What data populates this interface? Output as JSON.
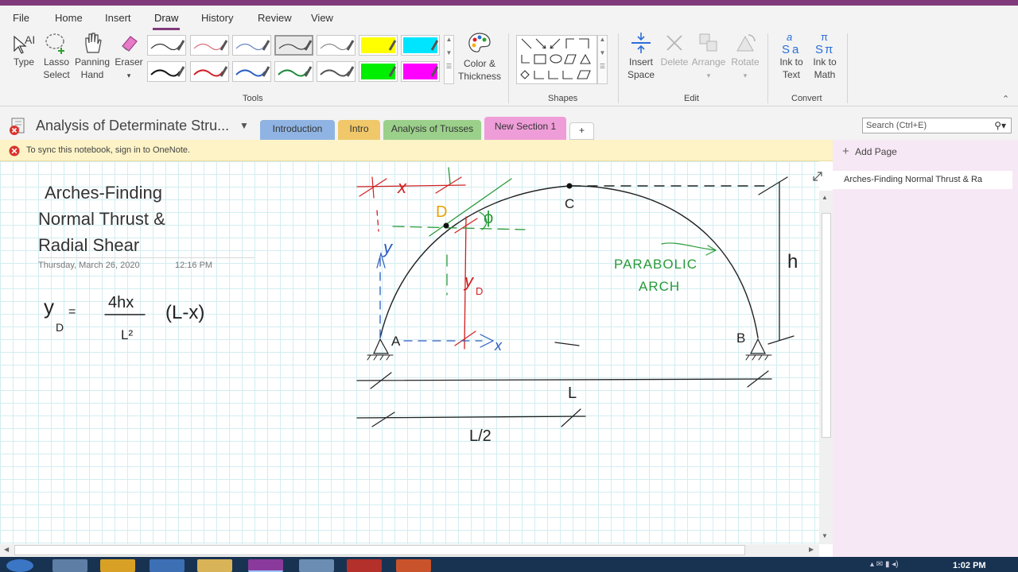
{
  "menu": {
    "items": [
      "File",
      "Home",
      "Insert",
      "Draw",
      "History",
      "Review",
      "View"
    ],
    "active": "Draw"
  },
  "ribbon": {
    "tools": {
      "type": "Type",
      "lasso": [
        "Lasso",
        "Select"
      ],
      "panning": [
        "Panning",
        "Hand"
      ],
      "eraser": "Eraser",
      "color_thickness": [
        "Color &",
        "Thickness"
      ],
      "insert_space": [
        "Insert",
        "Space"
      ],
      "delete": "Delete",
      "arrange": "Arrange",
      "rotate": "Rotate",
      "ink_to_text": [
        "Ink to",
        "Text"
      ],
      "ink_to_math": [
        "Ink to",
        "Math"
      ]
    },
    "groups": {
      "tools": "Tools",
      "shapes": "Shapes",
      "edit": "Edit",
      "convert": "Convert"
    },
    "pen_colors": [
      "#333333",
      "#d9707a",
      "#6b85c4",
      "#3c3c3c",
      "#8c8c8c",
      "#ffff00",
      "#00e5ff",
      "#111111",
      "#d0202a",
      "#2c5fc0",
      "#1f8a3c",
      "#555555",
      "#00ee00",
      "#ff00ff"
    ]
  },
  "notebook": {
    "title": "Analysis of Determinate Stru...",
    "tabs": [
      {
        "label": "Introduction",
        "color": "#8fb4e3"
      },
      {
        "label": "Intro",
        "color": "#f0c86a"
      },
      {
        "label": "Analysis of Trusses",
        "color": "#9bd08b"
      },
      {
        "label": "New Section 1",
        "color": "#ef9dd8"
      },
      {
        "label": "+",
        "color": "#ffffff"
      }
    ],
    "search_placeholder": "Search (Ctrl+E)"
  },
  "sync_message": "To sync this notebook, sign in to OneNote.",
  "page": {
    "title_lines": [
      "Arches-Finding",
      "Normal Thrust &",
      "Radial Shear"
    ],
    "date": "Thursday, March 26, 2020",
    "time": "12:16 PM"
  },
  "ink": {
    "x": "x",
    "y": "y",
    "D": "D",
    "phi": "ϕ",
    "yD": "y",
    "yD_sub": "D",
    "C": "C",
    "h": "h",
    "A": "A",
    "B": "B",
    "L": "L",
    "L2": "L/2",
    "parabolic": "PARABOLIC",
    "arch": "ARCH",
    "eq_lhs": "y",
    "eq_sub": "D",
    "eq_eq": "=",
    "eq_num": "4hx",
    "eq_den": "L²",
    "eq_tail": "(L-x)"
  },
  "sidebar": {
    "add_page": "Add Page",
    "pages": [
      "Arches-Finding  Normal Thrust &  Ra"
    ]
  },
  "taskbar": {
    "time": "1:02 PM"
  }
}
